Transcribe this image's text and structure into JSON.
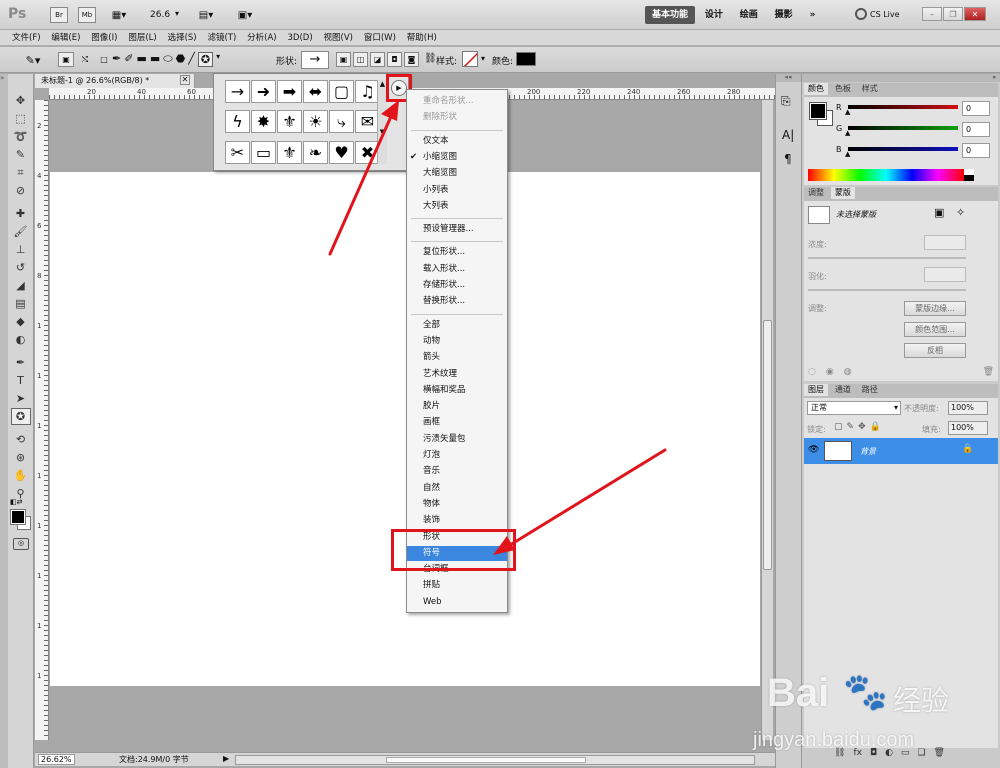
{
  "app": {
    "logo": "Ps",
    "zoom": "26.6",
    "workspaces": [
      "基本功能",
      "设计",
      "绘画",
      "摄影"
    ],
    "more": "»",
    "cslive": "CS Live"
  },
  "menu": [
    "文件(F)",
    "编辑(E)",
    "图像(I)",
    "图层(L)",
    "选择(S)",
    "滤镜(T)",
    "分析(A)",
    "3D(D)",
    "视图(V)",
    "窗口(W)",
    "帮助(H)"
  ],
  "options": {
    "shape_label": "形状:",
    "style_label": "样式:",
    "color_label": "颜色:",
    "color_value": "#000000"
  },
  "document": {
    "tab_title": "未标题-1 @ 26.6%(RGB/8) *",
    "ruler_marks": [
      "20",
      "40",
      "60",
      "200",
      "220",
      "240",
      "260",
      "280"
    ],
    "vruler_marks": [
      "2",
      "4",
      "6",
      "8",
      "1",
      "1",
      "1",
      "1",
      "1",
      "1",
      "1",
      "1"
    ]
  },
  "status": {
    "zoom": "26.62%",
    "doc": "文档:24.9M/0 字节"
  },
  "shape_picker": {
    "glyphs": [
      "→",
      "➜",
      "➡",
      "⬌",
      "▢",
      "♫",
      "ϟ",
      "✸",
      "⚜",
      "☀",
      "⤷",
      "✉",
      "✂",
      "▭",
      "⚜",
      "❧",
      "♥",
      "✖"
    ]
  },
  "dropdown": {
    "items": [
      {
        "label": "重命名形状...",
        "state": "disabled"
      },
      {
        "label": "删除形状",
        "state": "disabled"
      },
      {
        "sep": true
      },
      {
        "label": "仅文本",
        "state": ""
      },
      {
        "label": "小缩览图",
        "state": "checked"
      },
      {
        "label": "大缩览图",
        "state": ""
      },
      {
        "label": "小列表",
        "state": ""
      },
      {
        "label": "大列表",
        "state": ""
      },
      {
        "sep": true
      },
      {
        "label": "预设管理器...",
        "state": ""
      },
      {
        "sep": true
      },
      {
        "label": "复位形状...",
        "state": ""
      },
      {
        "label": "载入形状...",
        "state": ""
      },
      {
        "label": "存储形状...",
        "state": ""
      },
      {
        "label": "替换形状...",
        "state": ""
      },
      {
        "sep": true
      },
      {
        "label": "全部",
        "state": ""
      },
      {
        "label": "动物",
        "state": ""
      },
      {
        "label": "箭头",
        "state": ""
      },
      {
        "label": "艺术纹理",
        "state": ""
      },
      {
        "label": "横幅和奖品",
        "state": ""
      },
      {
        "label": "胶片",
        "state": ""
      },
      {
        "label": "画框",
        "state": ""
      },
      {
        "label": "污渍矢量包",
        "state": ""
      },
      {
        "label": "灯泡",
        "state": ""
      },
      {
        "label": "音乐",
        "state": ""
      },
      {
        "label": "自然",
        "state": ""
      },
      {
        "label": "物体",
        "state": ""
      },
      {
        "label": "装饰",
        "state": ""
      },
      {
        "label": "形状",
        "state": ""
      },
      {
        "label": "符号",
        "state": "selected"
      },
      {
        "label": "台词框",
        "state": ""
      },
      {
        "label": "拼贴",
        "state": ""
      },
      {
        "label": "Web",
        "state": ""
      }
    ]
  },
  "color_panel": {
    "tabs": [
      "颜色",
      "色板",
      "样式"
    ],
    "channels": [
      {
        "label": "R",
        "value": "0",
        "color": "#d01010"
      },
      {
        "label": "G",
        "value": "0",
        "color": "#10a010"
      },
      {
        "label": "B",
        "value": "0",
        "color": "#1010c0"
      }
    ]
  },
  "masks_panel": {
    "tabs": [
      "调整",
      "蒙版"
    ],
    "title": "未选择蒙版",
    "density_label": "浓度:",
    "feather_label": "羽化:",
    "refine_label": "调整:",
    "buttons": [
      "蒙版边缘...",
      "颜色范围...",
      "反相"
    ]
  },
  "layers_panel": {
    "tabs": [
      "图层",
      "通道",
      "路径"
    ],
    "blend_mode": "正常",
    "opacity_label": "不透明度:",
    "opacity": "100%",
    "lock_label": "锁定:",
    "fill_label": "填充:",
    "fill": "100%",
    "layer_name": "背景"
  },
  "watermark": {
    "brand": "Bai",
    "brand2": "经验",
    "url": "jingyan.baidu.com"
  }
}
